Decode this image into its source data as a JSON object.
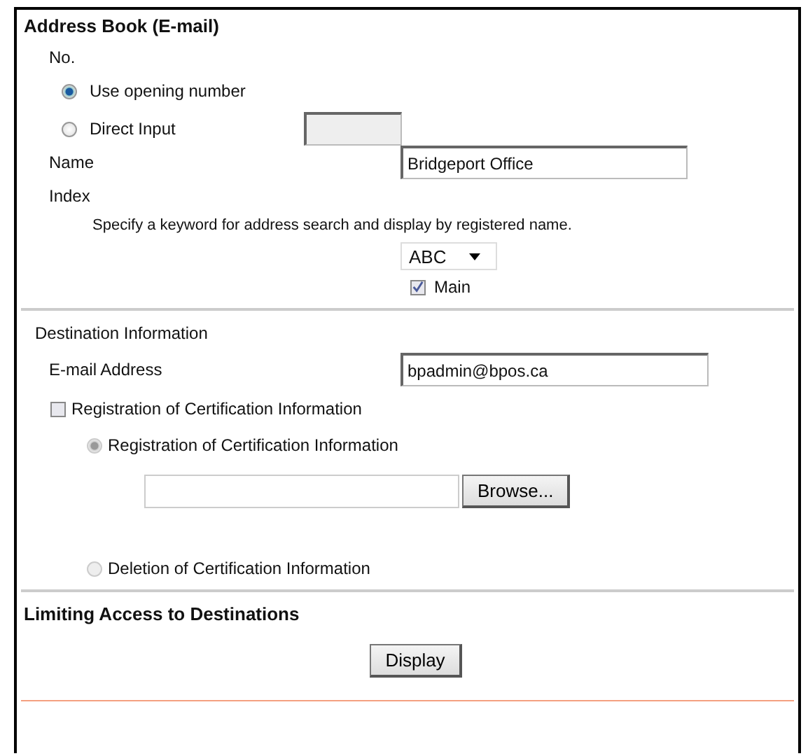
{
  "title": "Address Book (E-mail)",
  "number": {
    "label": "No.",
    "options": [
      {
        "label": "Use opening number",
        "selected": true
      },
      {
        "label": "Direct Input",
        "selected": false
      }
    ],
    "direct_input": {
      "disabled": true
    }
  },
  "name": {
    "label": "Name",
    "value": "Bridgeport Office"
  },
  "index": {
    "label": "Index",
    "hint": "Specify a keyword for address search and display by registered name.",
    "select_value": "ABC",
    "main": {
      "label": "Main",
      "checked": true
    }
  },
  "destination": {
    "heading": "Destination Information",
    "email_label": "E-mail Address",
    "email_value": "bpadmin@bpos.ca",
    "certification": {
      "label": "Registration of Certification Information",
      "checked": false,
      "options": [
        {
          "label": "Registration of Certification Information",
          "selected": true,
          "disabled": true
        },
        {
          "label": "Deletion of Certification Information",
          "selected": false,
          "disabled": true
        }
      ],
      "browse_button": "Browse..."
    }
  },
  "limiting": {
    "heading": "Limiting Access to Destinations",
    "display_button": "Display"
  }
}
